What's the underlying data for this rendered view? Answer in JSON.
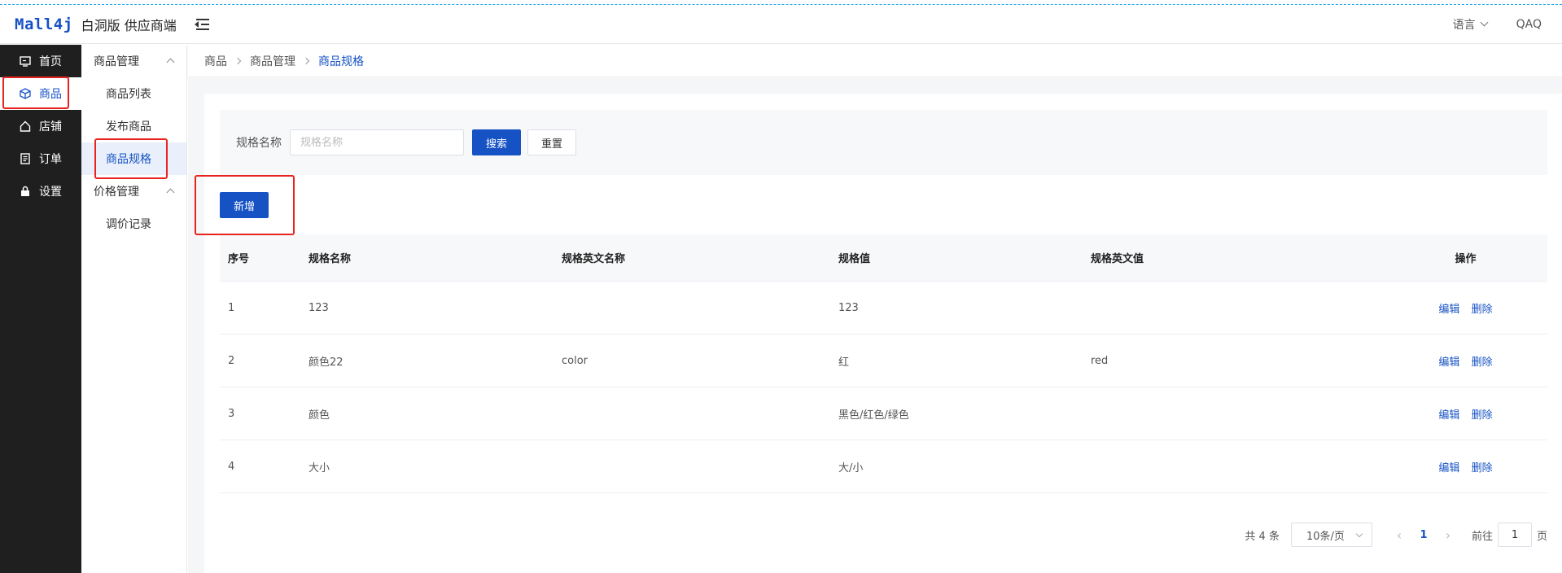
{
  "header": {
    "logo_mark": "Mall4j",
    "logo_text": "白洞版 供应商端",
    "language_label": "语言",
    "user_name": "QAQ"
  },
  "sidebar": {
    "items": [
      {
        "label": "首页",
        "icon": "monitor-icon"
      },
      {
        "label": "商品",
        "icon": "cube-icon"
      },
      {
        "label": "店铺",
        "icon": "home-icon"
      },
      {
        "label": "订单",
        "icon": "document-icon"
      },
      {
        "label": "设置",
        "icon": "lock-icon"
      }
    ]
  },
  "submenu": {
    "group1": "商品管理",
    "item1": "商品列表",
    "item2": "发布商品",
    "item3": "商品规格",
    "group2": "价格管理",
    "item4": "调价记录"
  },
  "breadcrumb": {
    "level1": "商品",
    "level2": "商品管理",
    "current": "商品规格"
  },
  "search": {
    "label": "规格名称",
    "placeholder": "规格名称",
    "value": "",
    "search_button": "搜索",
    "reset_button": "重置"
  },
  "toolbar": {
    "add_button": "新增"
  },
  "table": {
    "headers": [
      "序号",
      "规格名称",
      "规格英文名称",
      "规格值",
      "规格英文值",
      "操作"
    ],
    "rows": [
      {
        "index": "1",
        "name": "123",
        "name_en": "",
        "value": "123",
        "value_en": "",
        "edit": "编辑",
        "delete": "删除"
      },
      {
        "index": "2",
        "name": "颜色22",
        "name_en": "color",
        "value": "红",
        "value_en": "red",
        "edit": "编辑",
        "delete": "删除"
      },
      {
        "index": "3",
        "name": "颜色",
        "name_en": "",
        "value": "黑色/红色/绿色",
        "value_en": "",
        "edit": "编辑",
        "delete": "删除"
      },
      {
        "index": "4",
        "name": "大小",
        "name_en": "",
        "value": "大/小",
        "value_en": "",
        "edit": "编辑",
        "delete": "删除"
      }
    ]
  },
  "pagination": {
    "total": "共 4 条",
    "page_size": "10条/页",
    "current_page": "1",
    "goto_label": "前往",
    "goto_value": "1",
    "page_unit": "页"
  },
  "colors": {
    "primary": "#1652c4",
    "sidebar_bg": "#1f1f1f",
    "highlight": "#e8231f"
  }
}
